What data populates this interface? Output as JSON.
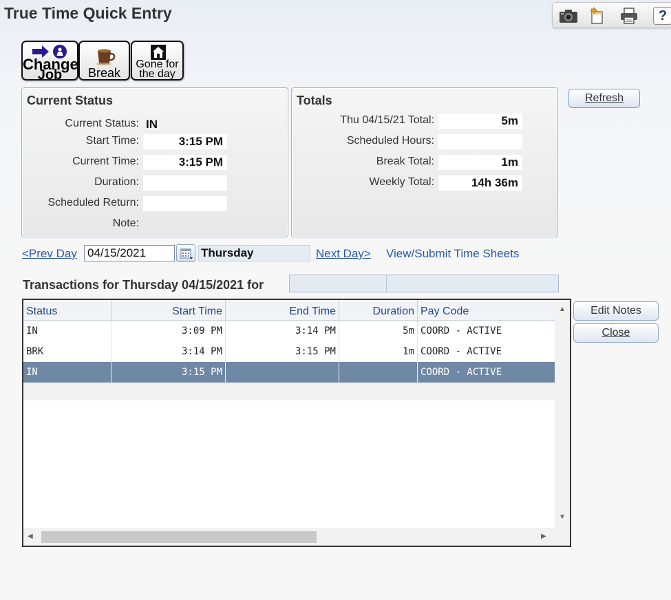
{
  "title": "True Time Quick Entry",
  "toolbar": {
    "icons": [
      "camera-icon",
      "new-window-icon",
      "printer-icon",
      "help-icon"
    ],
    "help_label": "?"
  },
  "actions": {
    "change_job": {
      "line1": "Change",
      "line2": "Job"
    },
    "break": {
      "label": "Break"
    },
    "gone": {
      "line1": "Gone for",
      "line2": "the day"
    }
  },
  "current_status": {
    "heading": "Current Status",
    "status_label": "Current Status:",
    "status_value": "IN",
    "start_label": "Start Time:",
    "start_value": "3:15 PM",
    "current_label": "Current Time:",
    "current_value": "3:15 PM",
    "duration_label": "Duration:",
    "duration_value": "",
    "return_label": "Scheduled Return:",
    "return_value": "",
    "note_label": "Note:"
  },
  "totals": {
    "heading": "Totals",
    "day_label": "Thu 04/15/21 Total:",
    "day_value": "5m",
    "sched_label": "Scheduled Hours:",
    "sched_value": "",
    "break_label": "Break Total:",
    "break_value": "1m",
    "weekly_label": "Weekly Total:",
    "weekly_value": "14h 36m"
  },
  "refresh_label": "Refresh",
  "nav": {
    "prev_label": "<Prev Day",
    "date_value": "04/15/2021",
    "day_name": "Thursday",
    "next_label": "Next Day>",
    "timesheets_label": "View/Submit Time Sheets"
  },
  "transactions_title": "Transactions for Thursday 04/15/2021 for",
  "grid": {
    "columns": [
      "Status",
      "Start Time",
      "End Time",
      "Duration",
      "Pay Code"
    ],
    "rows": [
      {
        "status": "IN",
        "start": "3:09 PM",
        "end": "3:14 PM",
        "duration": "5m",
        "pay_code": "COORD - ACTIVE"
      },
      {
        "status": "BRK",
        "start": "3:14 PM",
        "end": "3:15 PM",
        "duration": "1m",
        "pay_code": "COORD - ACTIVE"
      },
      {
        "status": "IN",
        "start": "3:15 PM",
        "end": "",
        "duration": "",
        "pay_code": "COORD - ACTIVE"
      }
    ],
    "selected_row": 2
  },
  "side_buttons": {
    "edit_notes": "Edit Notes",
    "close": "Close"
  },
  "colors": {
    "selected_row": "#6f88a6",
    "link": "#2a5aa5",
    "header_text": "#1f4a88"
  }
}
